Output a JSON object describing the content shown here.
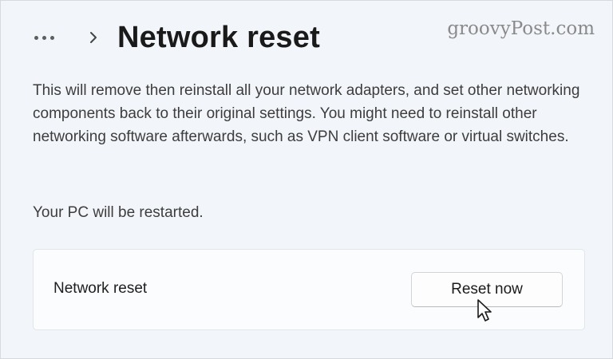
{
  "header": {
    "more_icon": "more-horizontal-icon",
    "chevron_icon": "chevron-right-icon",
    "title": "Network reset"
  },
  "watermark": "groovyPost.com",
  "description": "This will remove then reinstall all your network adapters, and set other networking components back to their original settings. You might need to reinstall other networking software afterwards, such as VPN client software or virtual switches.",
  "restart_note": "Your PC will be restarted.",
  "card": {
    "label": "Network reset",
    "button_label": "Reset now"
  },
  "cursor_icon": "arrow-cursor-icon"
}
